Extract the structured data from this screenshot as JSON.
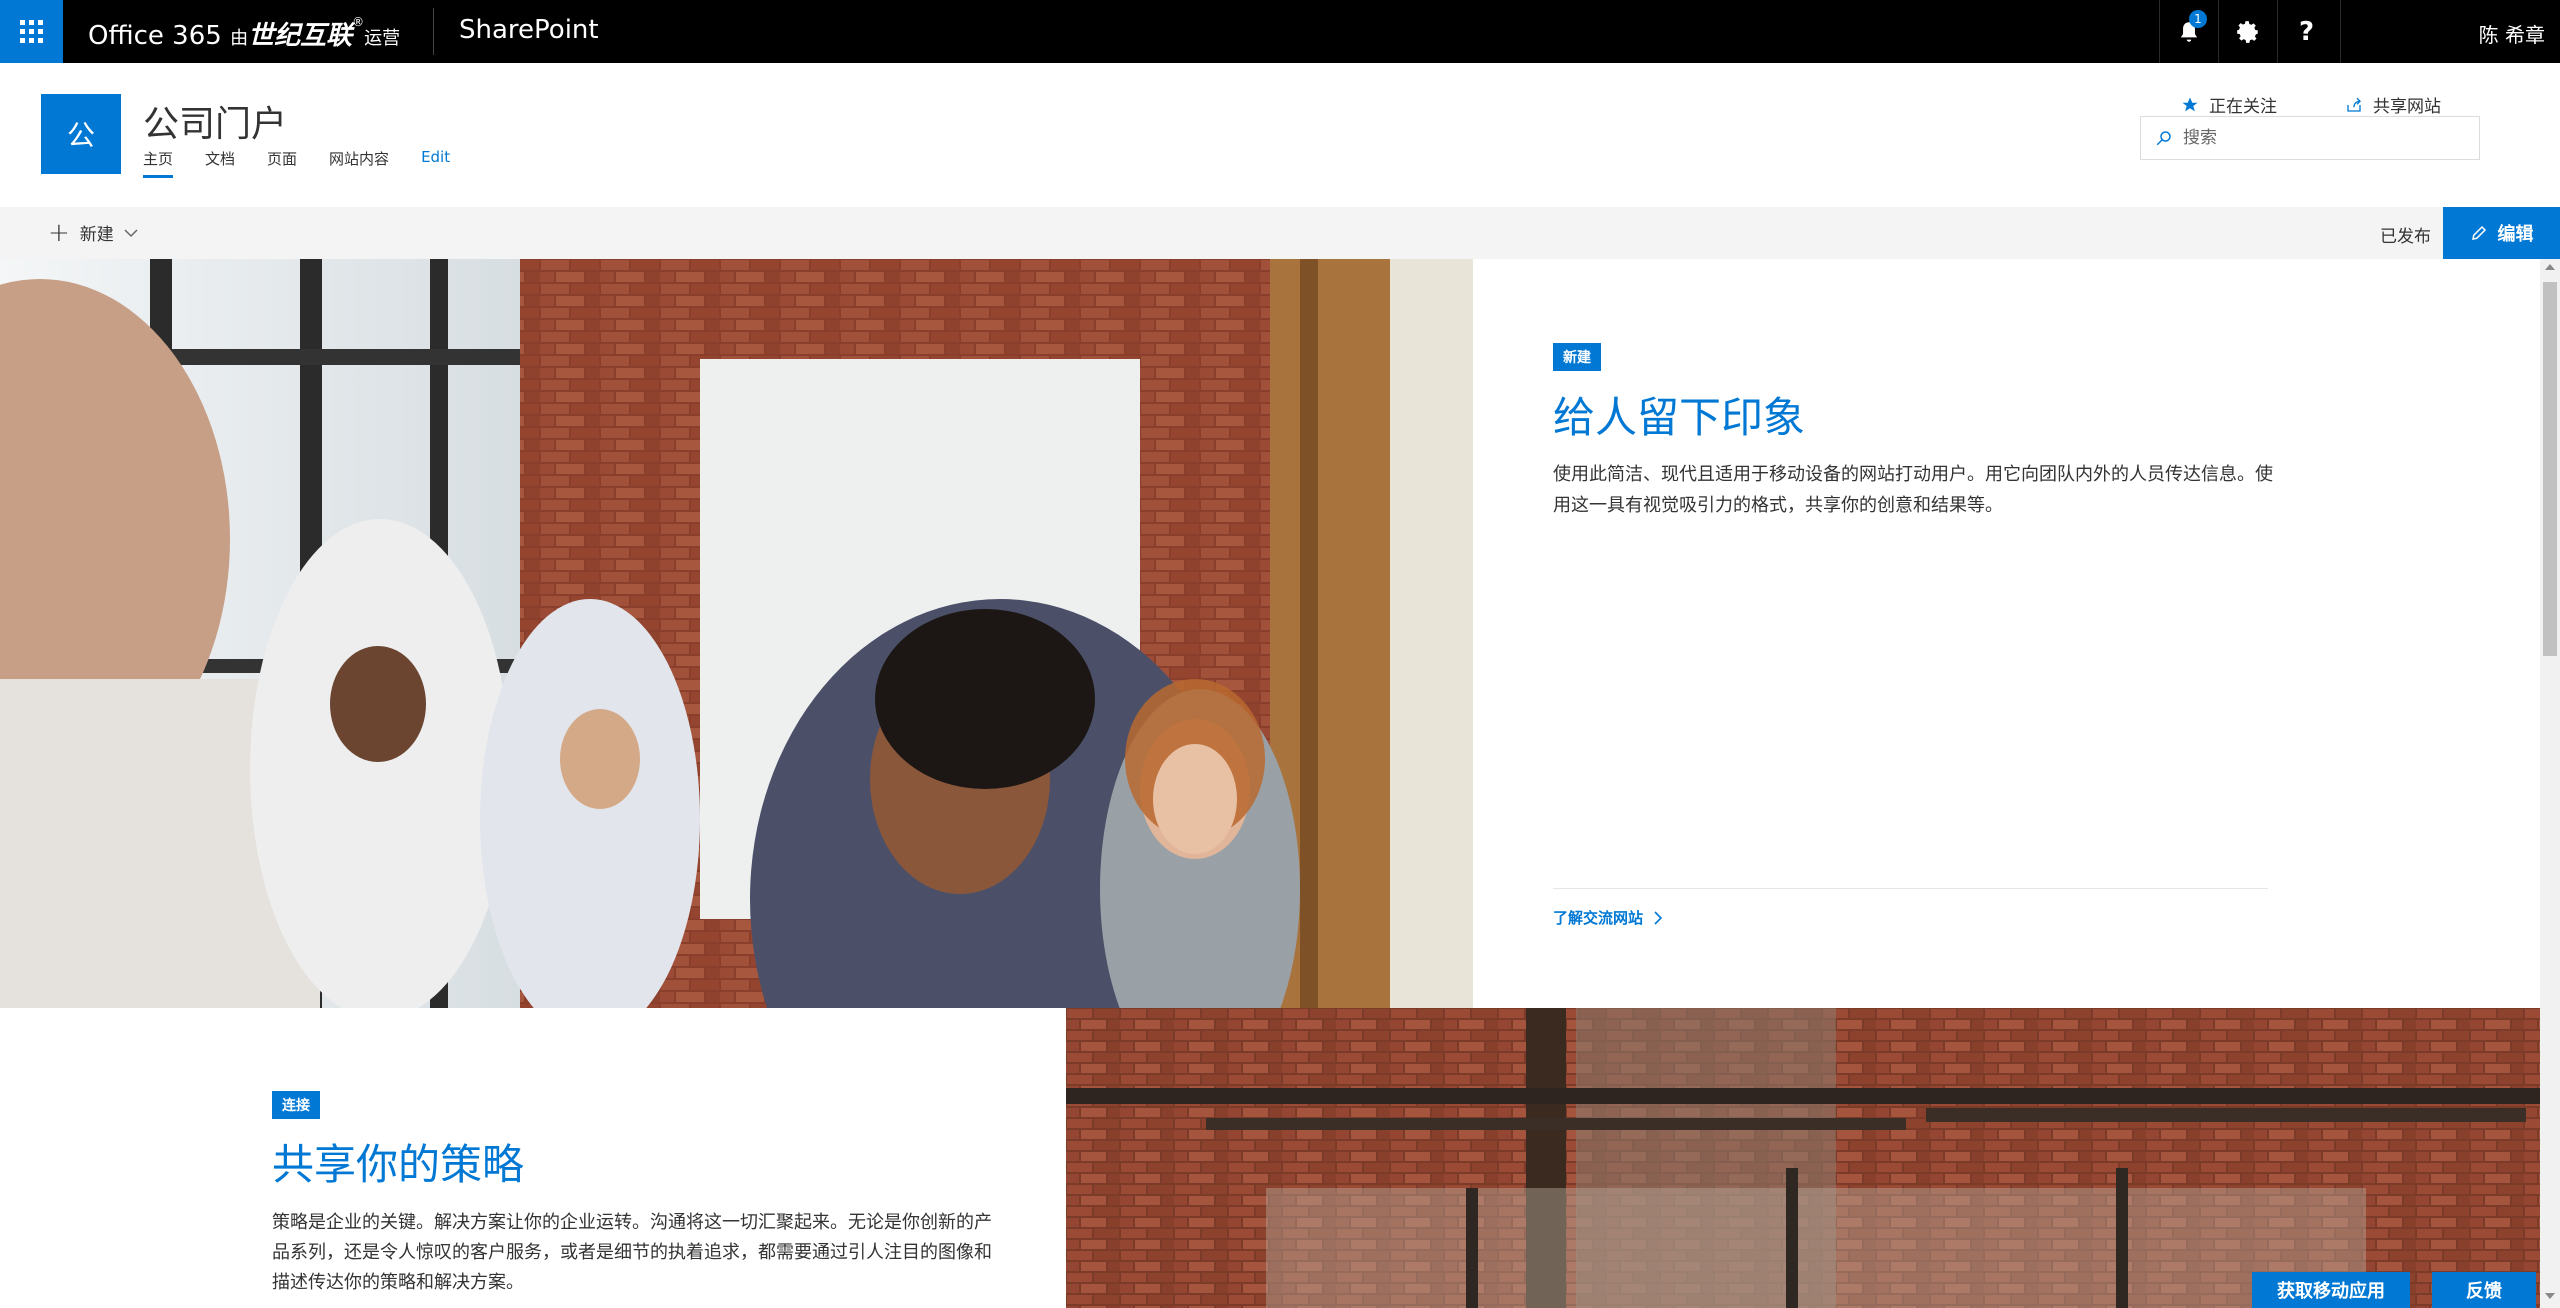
{
  "suite_bar": {
    "brand_prefix": "Office 365",
    "brand_by": "由",
    "brand_company": "世纪互联",
    "brand_mark": "®",
    "brand_suffix": "运营",
    "app_name": "SharePoint",
    "notification_count": "1",
    "user_name": "陈 希章"
  },
  "site": {
    "logo_letter": "公",
    "title": "公司门户",
    "nav": [
      "主页",
      "文档",
      "页面",
      "网站内容",
      "Edit"
    ],
    "follow_label": "正在关注",
    "share_label": "共享网站",
    "search_placeholder": "搜索"
  },
  "command_bar": {
    "new_label": "新建",
    "status": "已发布",
    "edit_label": "编辑"
  },
  "hero1": {
    "tag": "新建",
    "title": "给人留下印象",
    "description": "使用此简洁、现代且适用于移动设备的网站打动用户。用它向团队内外的人员传达信息。使用这一具有视觉吸引力的格式，共享你的创意和结果等。",
    "link": "了解交流网站"
  },
  "hero2": {
    "tag": "连接",
    "title": "共享你的策略",
    "description": "策略是企业的关键。解决方案让你的企业运转。沟通将这一切汇聚起来。无论是你创新的产品系列，还是令人惊叹的客户服务，或者是细节的执着追求，都需要通过引人注目的图像和描述传达你的策略和解决方案。"
  },
  "footer_buttons": {
    "get_app": "获取移动应用",
    "feedback": "反馈"
  },
  "colors": {
    "accent": "#0078d4",
    "suite_bar": "#000000",
    "command_bar": "#f4f4f4"
  }
}
